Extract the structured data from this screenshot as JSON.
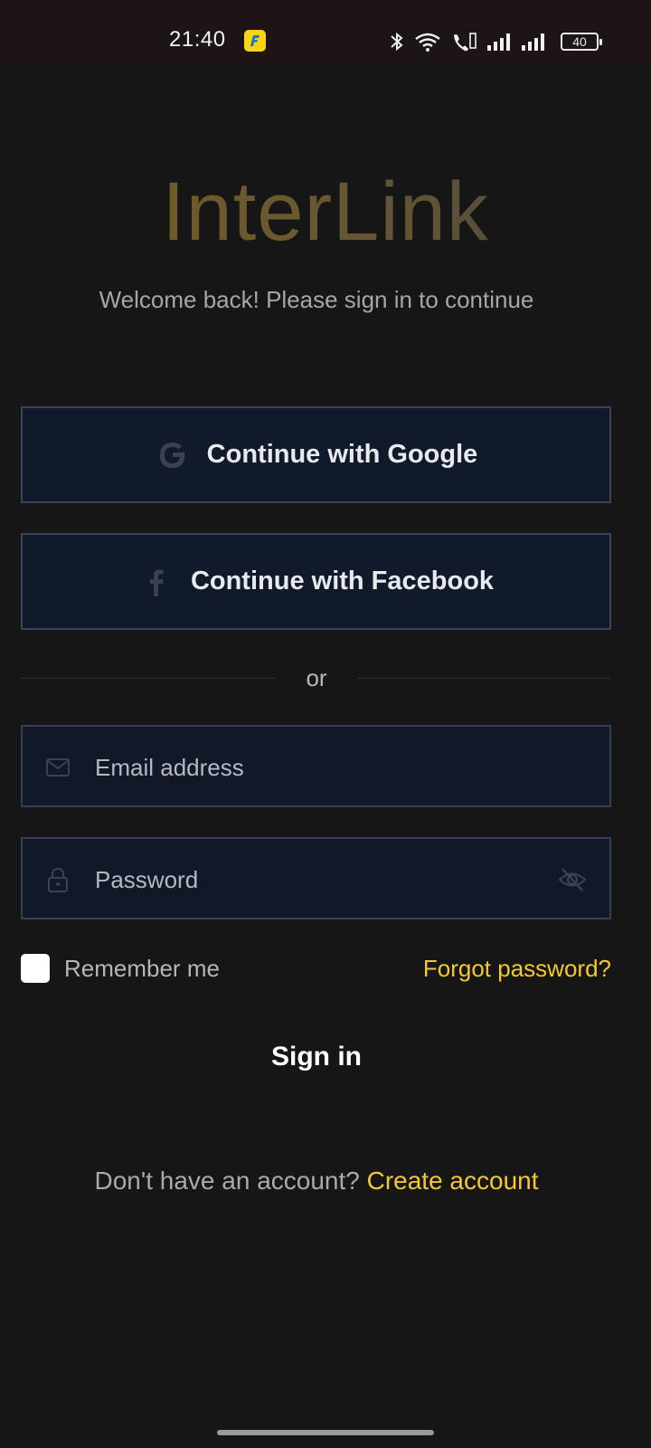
{
  "status_bar": {
    "time": "21:40",
    "battery": "40",
    "icons": [
      "app-badge-icon",
      "bluetooth-icon",
      "wifi-icon",
      "call-icon",
      "signal-icon",
      "signal-icon",
      "battery-icon"
    ]
  },
  "brand": {
    "logo": "InterLink",
    "subtitle": "Welcome back! Please sign in to continue"
  },
  "social": {
    "google_label": "Continue with Google",
    "facebook_label": "Continue with Facebook",
    "divider_text": "or"
  },
  "form": {
    "email_placeholder": "Email address",
    "password_placeholder": "Password",
    "remember_label": "Remember me",
    "remember_checked": false,
    "forgot_label": "Forgot password?",
    "signin_label": "Sign in"
  },
  "footer": {
    "question": "Don't have an account? ",
    "create_label": "Create account"
  },
  "colors": {
    "background": "#161617",
    "accent": "#f5c830",
    "button_bg": "#111a2b",
    "border": "#3a4458"
  }
}
